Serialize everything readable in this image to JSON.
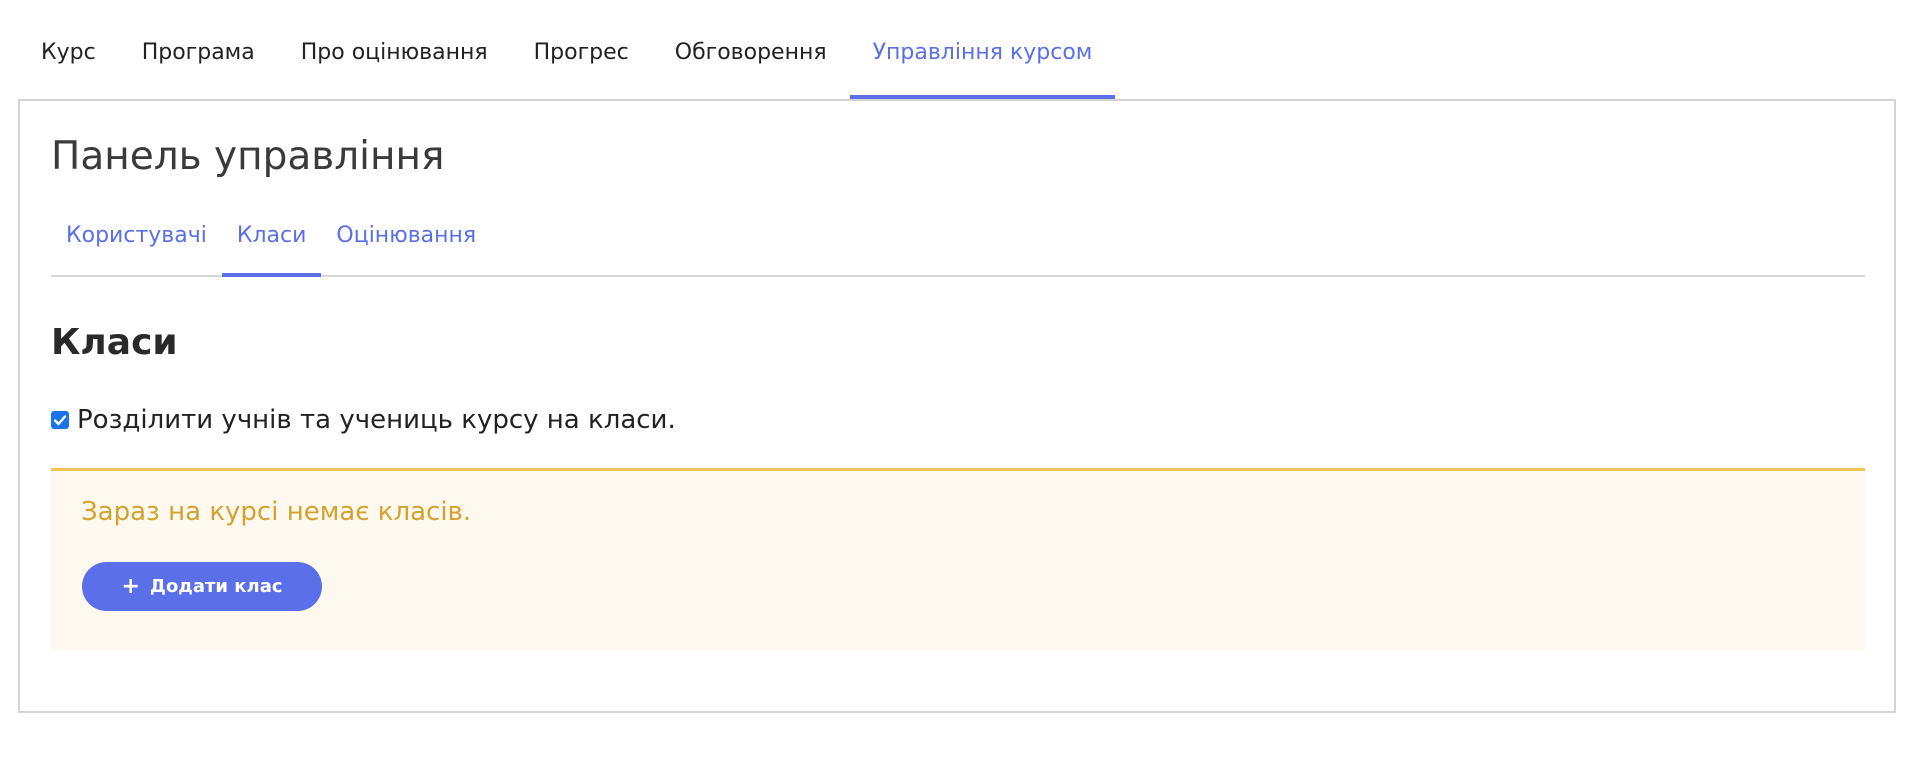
{
  "course_nav": {
    "tabs": [
      {
        "label": "Курс"
      },
      {
        "label": "Програма"
      },
      {
        "label": "Про оцінювання"
      },
      {
        "label": "Прогрес"
      },
      {
        "label": "Обговорення"
      },
      {
        "label": "Управління курсом"
      }
    ],
    "active": "Управління курсом"
  },
  "panel": {
    "title": "Панель управління",
    "sub_tabs": [
      {
        "label": "Користувачі"
      },
      {
        "label": "Класи"
      },
      {
        "label": "Оцінювання"
      }
    ],
    "active_sub_tab": "Класи"
  },
  "section": {
    "heading": "Класи",
    "checkbox_label": "Розділити учнів та учениць курсу на класи.",
    "checkbox_checked": true
  },
  "alert": {
    "message": "Зараз на курсі немає класів.",
    "add_button_label": "Додати клас",
    "add_button_icon": "plus-icon"
  },
  "colors": {
    "accent": "#5b6fe8",
    "alert_background": "#fdf9ee",
    "alert_border": "#f0c652",
    "alert_text": "#d4a22e",
    "checkbox": "#1a73e8"
  }
}
